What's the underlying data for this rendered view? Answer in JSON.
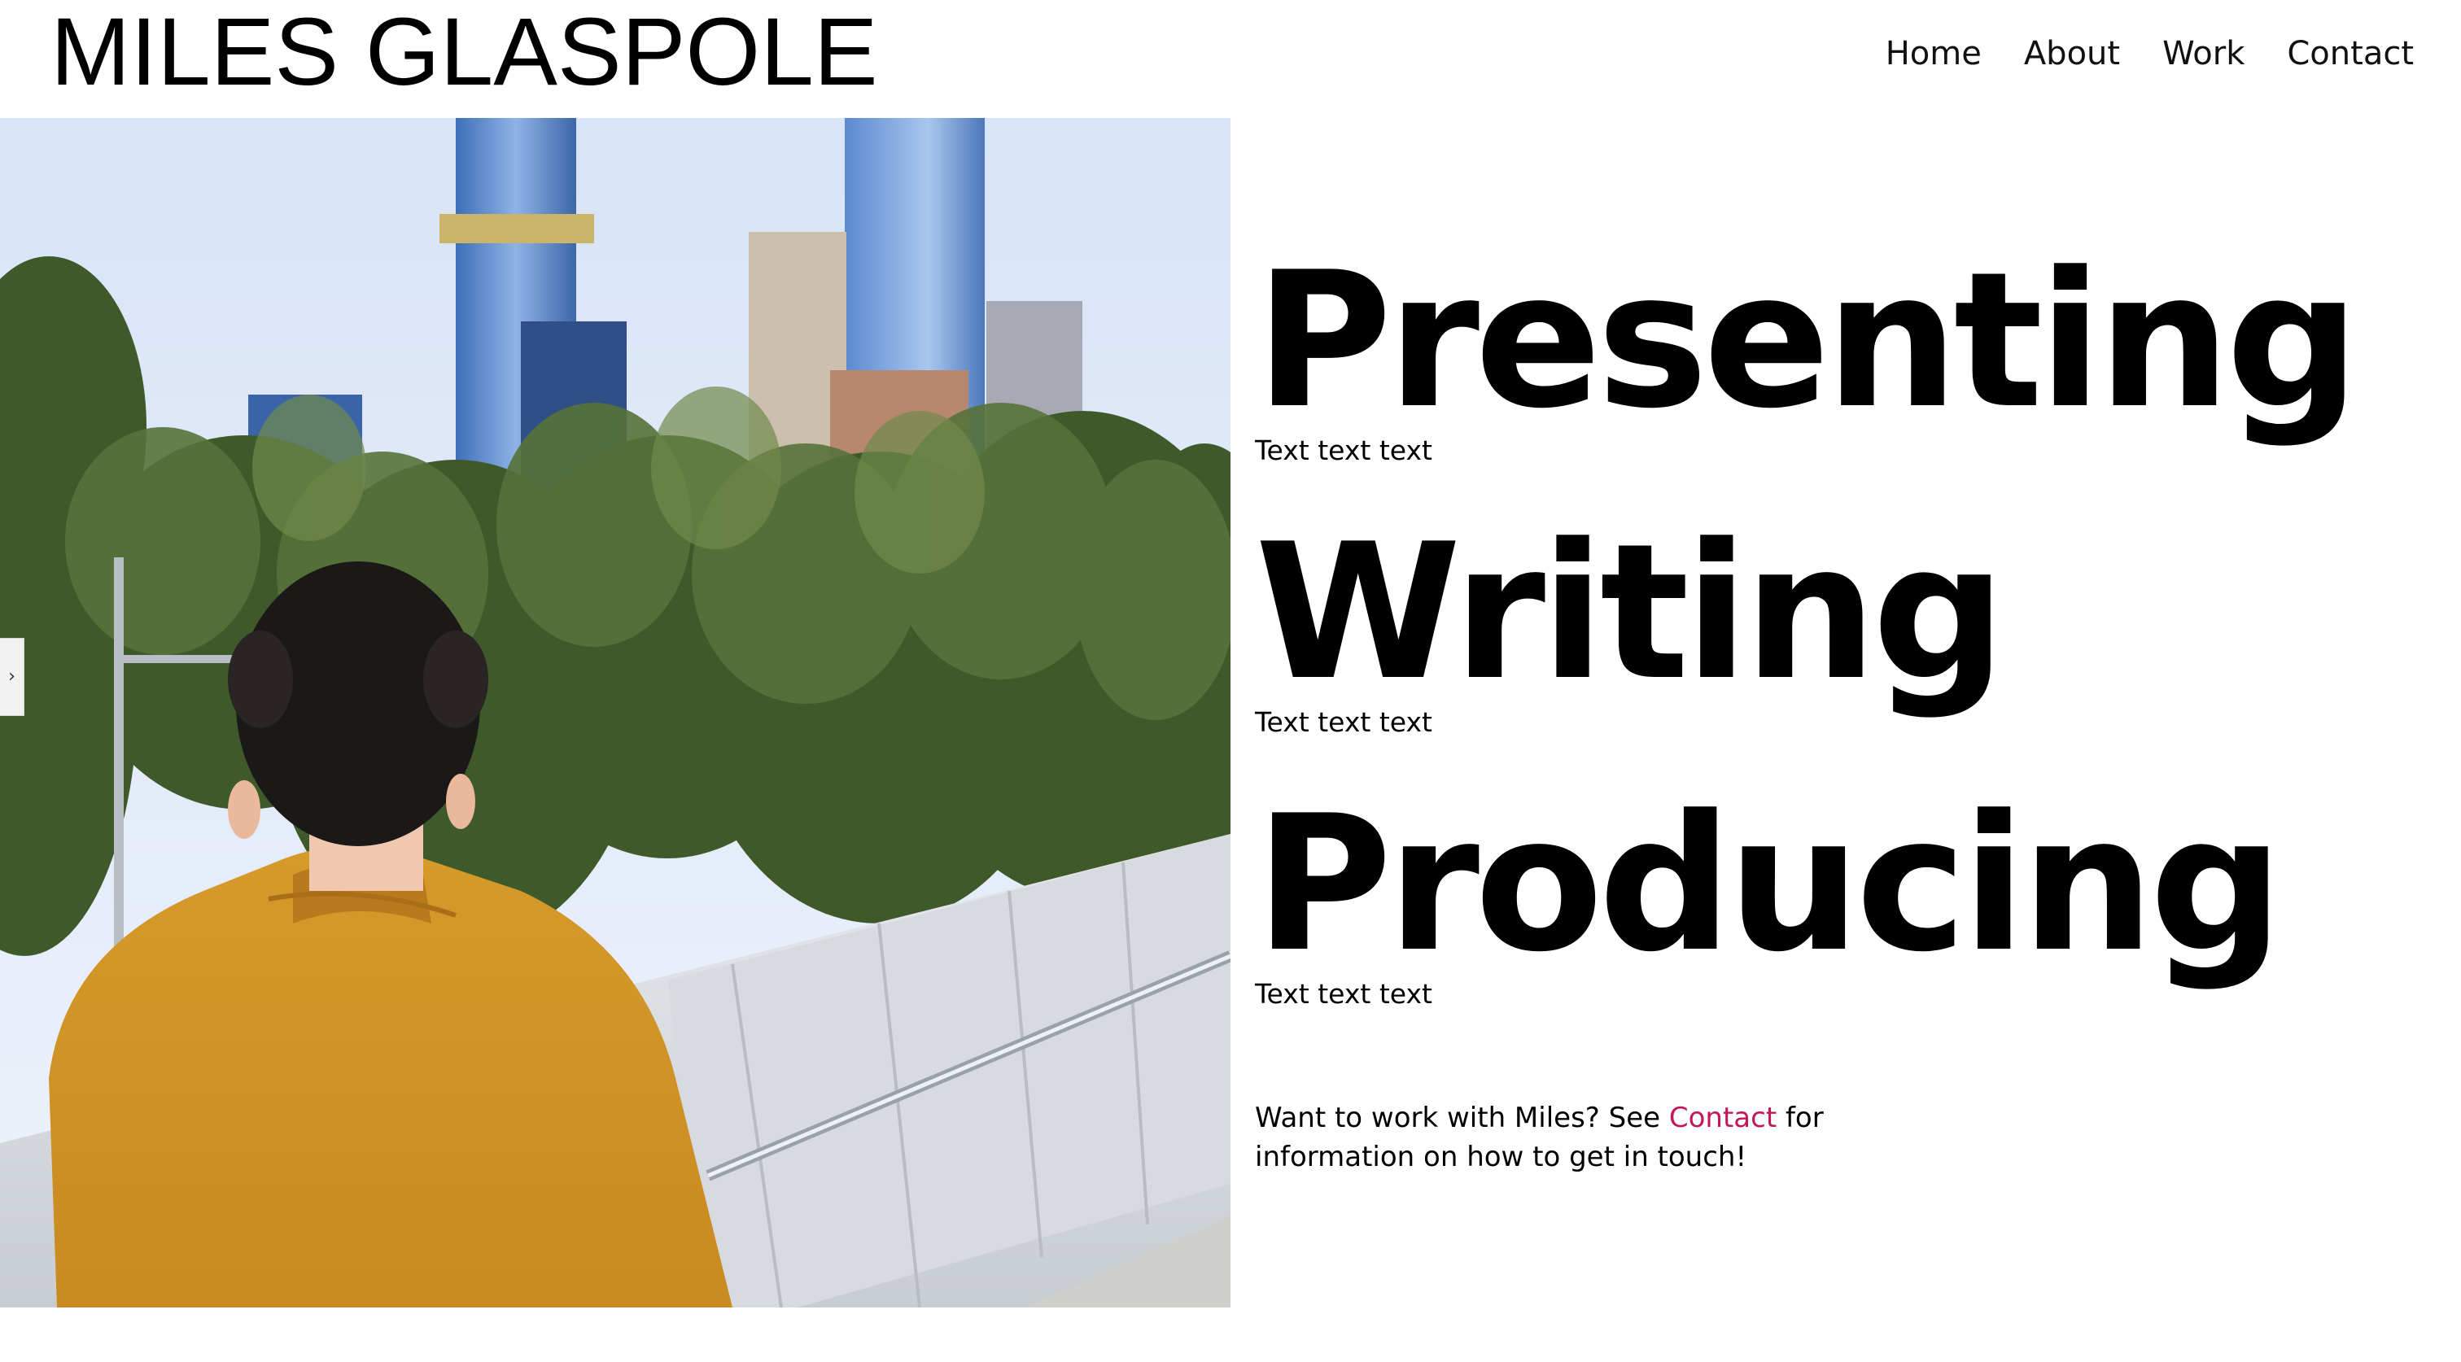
{
  "header": {
    "site_title": "MILES GLASPOLE",
    "nav": [
      "Home",
      "About",
      "Work",
      "Contact"
    ]
  },
  "hero": {
    "description": "",
    "gallery_arrow": "›"
  },
  "services": [
    {
      "title": "Presenting",
      "text": "Text text text"
    },
    {
      "title": "Writing",
      "text": "Text text text"
    },
    {
      "title": "Producing",
      "text": "Text text text"
    }
  ],
  "cta": {
    "before": "Want to work with Miles? See ",
    "link": "Contact",
    "after": " for information on how to get in touch!"
  },
  "colors": {
    "link_accent": "#c2185b",
    "text": "#000000",
    "background": "#ffffff"
  }
}
